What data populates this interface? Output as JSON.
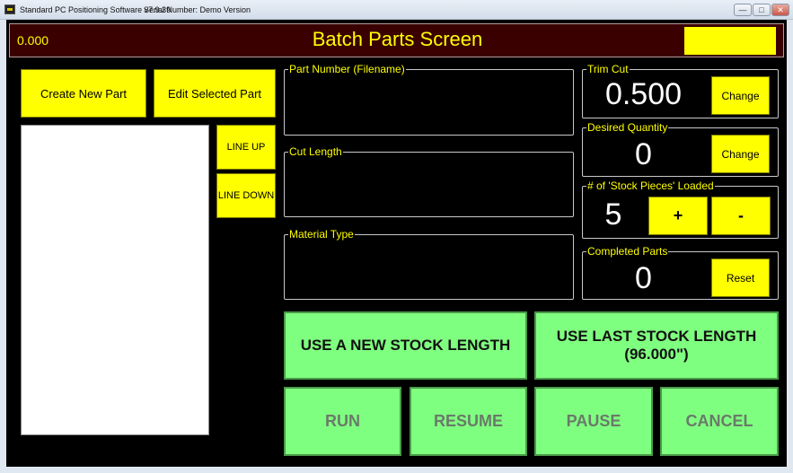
{
  "window": {
    "title": "Standard PC Positioning Software v7.9.39",
    "serial": "Serial Number: Demo Version",
    "controls": {
      "minimize": "—",
      "maximize": "□",
      "close": "✕"
    }
  },
  "header": {
    "position_readout": "0.000",
    "screen_title": "Batch Parts Screen",
    "status_color": "#ffff00"
  },
  "left_panel": {
    "create_label": "Create New Part",
    "edit_label": "Edit Selected Part",
    "line_up_label": "LINE UP",
    "line_down_label": "LINE DOWN",
    "parts": []
  },
  "fields": {
    "part_number_label": "Part Number (Filename)",
    "part_number_value": "",
    "cut_length_label": "Cut Length",
    "cut_length_value": "",
    "material_type_label": "Material Type",
    "material_type_value": ""
  },
  "settings": {
    "trim_cut_label": "Trim Cut",
    "trim_cut_value": "0.500",
    "trim_change_label": "Change",
    "desired_qty_label": "Desired Quantity",
    "desired_qty_value": "0",
    "qty_change_label": "Change",
    "stock_loaded_label": "# of 'Stock Pieces' Loaded",
    "stock_loaded_value": "5",
    "plus_label": "+",
    "minus_label": "-",
    "completed_label": "Completed Parts",
    "completed_value": "0",
    "reset_label": "Reset"
  },
  "actions": {
    "new_stock_label": "USE A NEW STOCK LENGTH",
    "last_stock_label_line1": "USE LAST STOCK LENGTH",
    "last_stock_label_line2": "(96.000\")",
    "run_label": "RUN",
    "resume_label": "RESUME",
    "pause_label": "PAUSE",
    "cancel_label": "CANCEL"
  },
  "colors": {
    "accent_yellow": "#ffff00",
    "action_green": "#7fff7f",
    "header_bg": "#3a0000",
    "disabled_text": "#6a7a6a"
  }
}
